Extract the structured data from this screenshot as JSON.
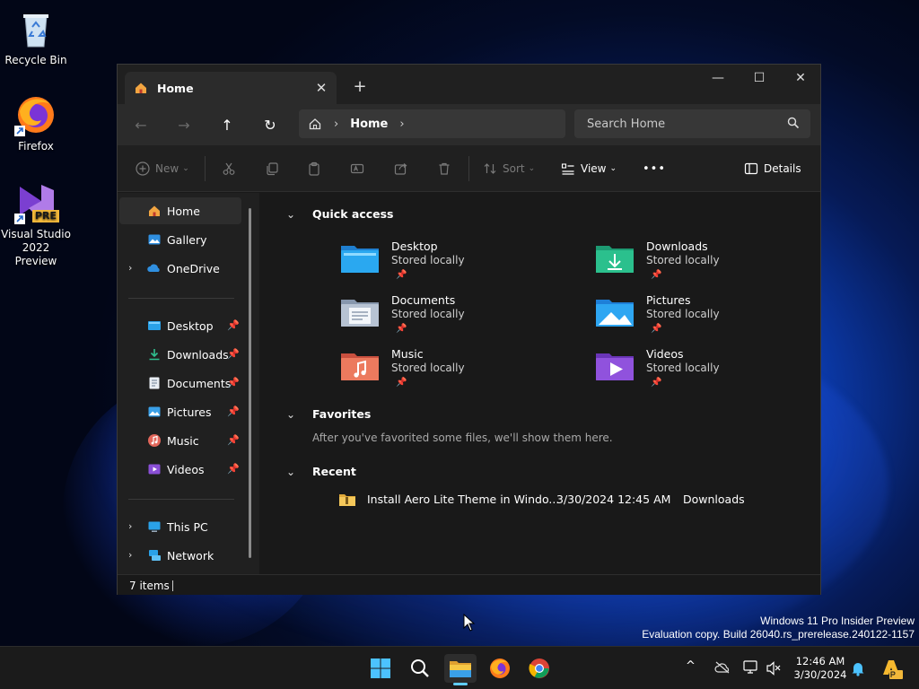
{
  "desktop": {
    "icons": [
      {
        "label": "Recycle Bin"
      },
      {
        "label": "Firefox"
      },
      {
        "label": "Visual Studio 2022 Preview",
        "badge": "PRE"
      }
    ],
    "watermark_line1": "Windows 11 Pro Insider Preview",
    "watermark_line2": "Evaluation copy. Build 26040.rs_prerelease.240122-1157"
  },
  "window": {
    "tab_title": "Home",
    "tab_close": "✕",
    "new_tab": "+",
    "controls": {
      "minimize": "—",
      "maximize": "☐",
      "close": "✕"
    },
    "nav": {
      "back": "←",
      "forward": "→",
      "up": "↑",
      "refresh": "↻"
    },
    "address": {
      "sep": "›",
      "crumb": "Home"
    },
    "search_placeholder": "Search Home",
    "toolbar": {
      "new_label": "New",
      "sort_label": "Sort",
      "view_label": "View",
      "more_label": "•••",
      "details_label": "Details",
      "dropdown_caret": "⌄"
    },
    "sidebar": {
      "top": [
        {
          "label": "Home",
          "icon": "home-icon",
          "selected": true
        },
        {
          "label": "Gallery",
          "icon": "gallery-icon"
        },
        {
          "label": "OneDrive",
          "icon": "onedrive-icon",
          "expandable": true
        }
      ],
      "pinned": [
        {
          "label": "Desktop",
          "icon": "desktop-folder-icon"
        },
        {
          "label": "Downloads",
          "icon": "downloads-icon"
        },
        {
          "label": "Documents",
          "icon": "documents-icon"
        },
        {
          "label": "Pictures",
          "icon": "pictures-icon"
        },
        {
          "label": "Music",
          "icon": "music-icon"
        },
        {
          "label": "Videos",
          "icon": "videos-icon"
        }
      ],
      "bottom": [
        {
          "label": "This PC",
          "icon": "this-pc-icon"
        },
        {
          "label": "Network",
          "icon": "network-icon"
        }
      ],
      "chevron": "›",
      "pin": "📌"
    },
    "quick_access": {
      "title": "Quick access",
      "items": [
        {
          "name": "Desktop",
          "status": "Stored locally"
        },
        {
          "name": "Downloads",
          "status": "Stored locally"
        },
        {
          "name": "Documents",
          "status": "Stored locally"
        },
        {
          "name": "Pictures",
          "status": "Stored locally"
        },
        {
          "name": "Music",
          "status": "Stored locally"
        },
        {
          "name": "Videos",
          "status": "Stored locally"
        }
      ]
    },
    "favorites": {
      "title": "Favorites",
      "empty_text": "After you've favorited some files, we'll show them here."
    },
    "recent": {
      "title": "Recent",
      "items": [
        {
          "name": "Install Aero Lite Theme in Windo...",
          "date": "3/30/2024 12:45 AM",
          "location": "Downloads"
        }
      ]
    },
    "section_caret": "⌄",
    "status": {
      "item_count": "7 items"
    }
  },
  "taskbar": {
    "clock_time": "12:46 AM",
    "clock_date": "3/30/2024",
    "tray_chevron": "^"
  }
}
